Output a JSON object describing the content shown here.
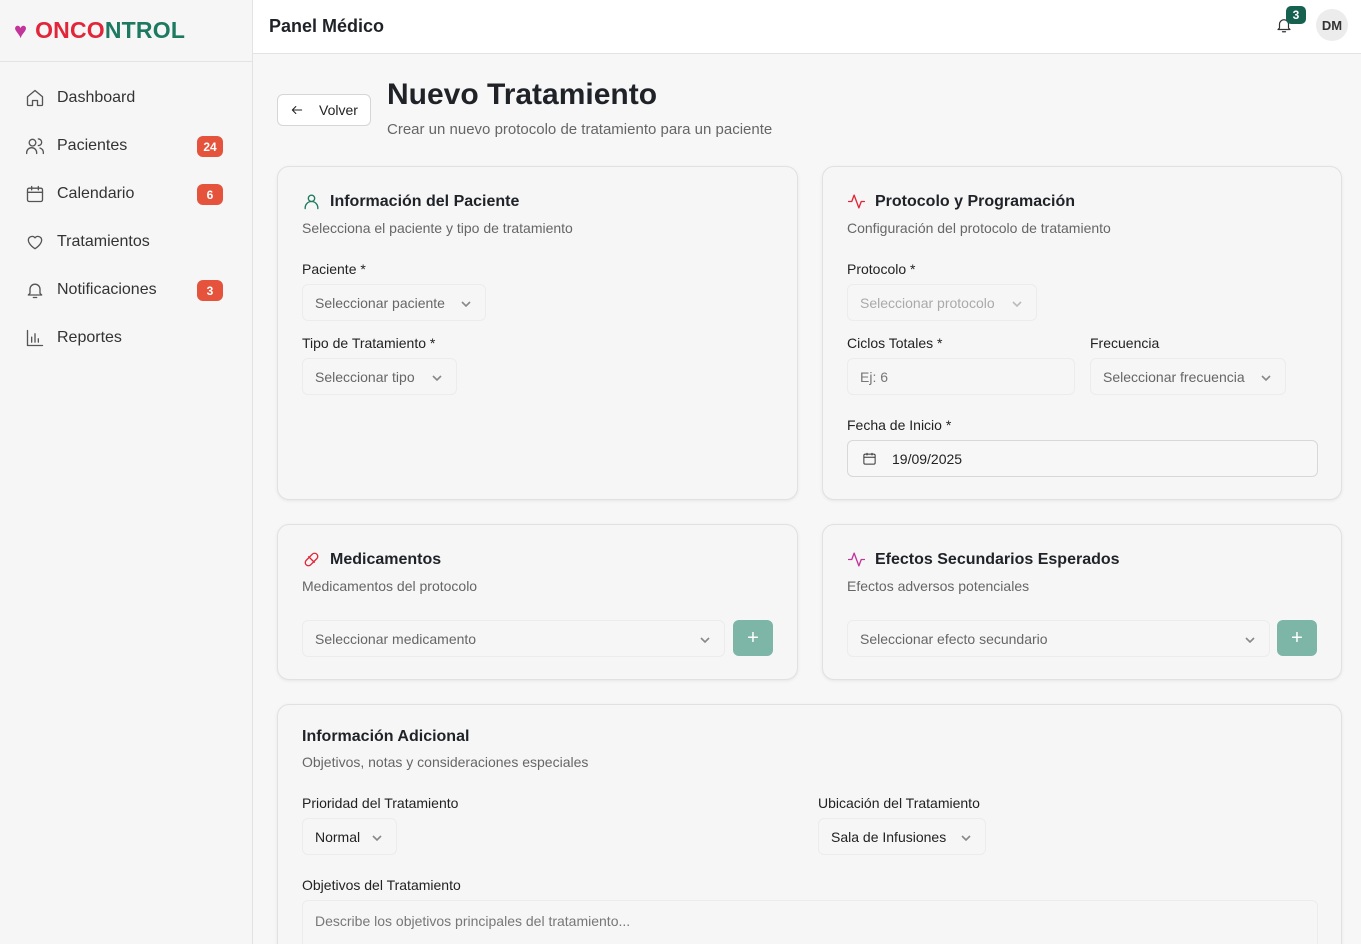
{
  "brand": {
    "part1": "ONCO",
    "part2": "NTROL"
  },
  "sidebar": {
    "items": [
      {
        "label": "Dashboard",
        "icon": "home-icon",
        "badge": ""
      },
      {
        "label": "Pacientes",
        "icon": "users-icon",
        "badge": "24"
      },
      {
        "label": "Calendario",
        "icon": "calendar-icon",
        "badge": "6"
      },
      {
        "label": "Tratamientos",
        "icon": "heart-icon",
        "badge": ""
      },
      {
        "label": "Notificaciones",
        "icon": "bell-icon",
        "badge": "3"
      },
      {
        "label": "Reportes",
        "icon": "bar-chart-icon",
        "badge": ""
      }
    ]
  },
  "header": {
    "title": "Panel Médico",
    "notification_count": "3",
    "avatar_initials": "DM"
  },
  "page": {
    "back_label": "Volver",
    "title": "Nuevo Tratamiento",
    "subtitle": "Crear un nuevo protocolo de tratamiento para un paciente"
  },
  "patient_card": {
    "title": "Información del Paciente",
    "subtitle": "Selecciona el paciente y tipo de tratamiento",
    "patient_label": "Paciente *",
    "patient_placeholder": "Seleccionar paciente",
    "type_label": "Tipo de Tratamiento *",
    "type_placeholder": "Seleccionar tipo"
  },
  "protocol_card": {
    "title": "Protocolo y Programación",
    "subtitle": "Configuración del protocolo de tratamiento",
    "protocol_label": "Protocolo *",
    "protocol_placeholder": "Seleccionar protocolo",
    "cycles_label": "Ciclos Totales *",
    "cycles_placeholder": "Ej: 6",
    "frequency_label": "Frecuencia",
    "frequency_placeholder": "Seleccionar frecuencia",
    "start_label": "Fecha de Inicio *",
    "start_value": "19/09/2025"
  },
  "meds_card": {
    "title": "Medicamentos",
    "subtitle": "Medicamentos del protocolo",
    "placeholder": "Seleccionar medicamento",
    "add": "+"
  },
  "effects_card": {
    "title": "Efectos Secundarios Esperados",
    "subtitle": "Efectos adversos potenciales",
    "placeholder": "Seleccionar efecto secundario",
    "add": "+"
  },
  "additional_card": {
    "title": "Información Adicional",
    "subtitle": "Objetivos, notas y consideraciones especiales",
    "priority_label": "Prioridad del Tratamiento",
    "priority_value": "Normal",
    "location_label": "Ubicación del Tratamiento",
    "location_value": "Sala de Infusiones",
    "objectives_label": "Objetivos del Tratamiento",
    "objectives_placeholder": "Describe los objetivos principales del tratamiento..."
  },
  "colors": {
    "brand_red": "#e2263a",
    "brand_green": "#1d7a61",
    "badge": "#e5533d",
    "accent": "#16614f",
    "add_button": "#7db5a6"
  }
}
